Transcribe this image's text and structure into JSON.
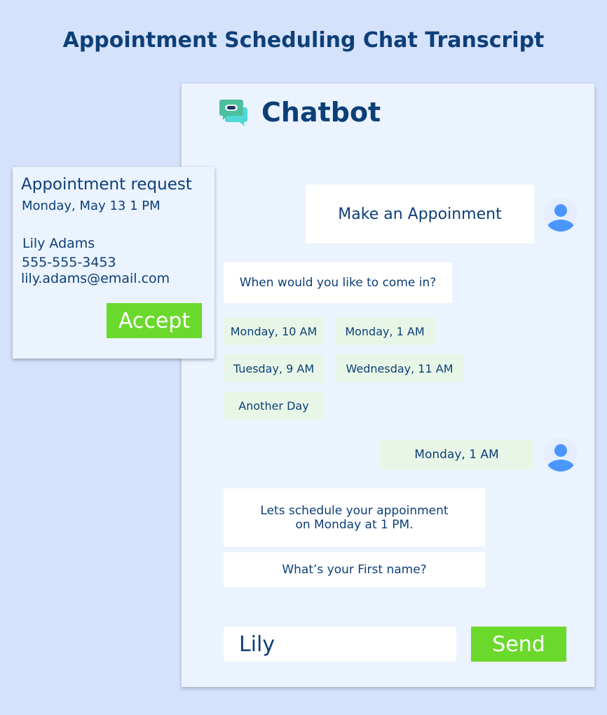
{
  "title": "Appointment Scheduling Chat Transcript",
  "chat": {
    "brand": "Chatbot",
    "user_msg1": "Make an Appoinment",
    "bot_q1": "When would you like to come in?",
    "options": [
      "Monday, 10 AM",
      "Monday, 1 AM",
      "Tuesday, 9 AM",
      "Wednesday, 11 AM",
      "Another Day"
    ],
    "user_msg2": "Monday, 1 AM",
    "bot_msg2_line1": "Lets schedule your appoinment",
    "bot_msg2_line2": "on Monday at 1 PM.",
    "bot_q2": "What’s your First name?",
    "input_value": "Lily",
    "send_label": "Send"
  },
  "card": {
    "heading": "Appointment request",
    "datetime": "Monday, May 13 1 PM",
    "name": "Lily Adams",
    "phone": "555-555-3453",
    "email": "lily.adams@email.com",
    "accept_label": "Accept"
  },
  "colors": {
    "accent": "#6bd92c",
    "text": "#0d3f78",
    "avatar": "#4a96ff"
  }
}
